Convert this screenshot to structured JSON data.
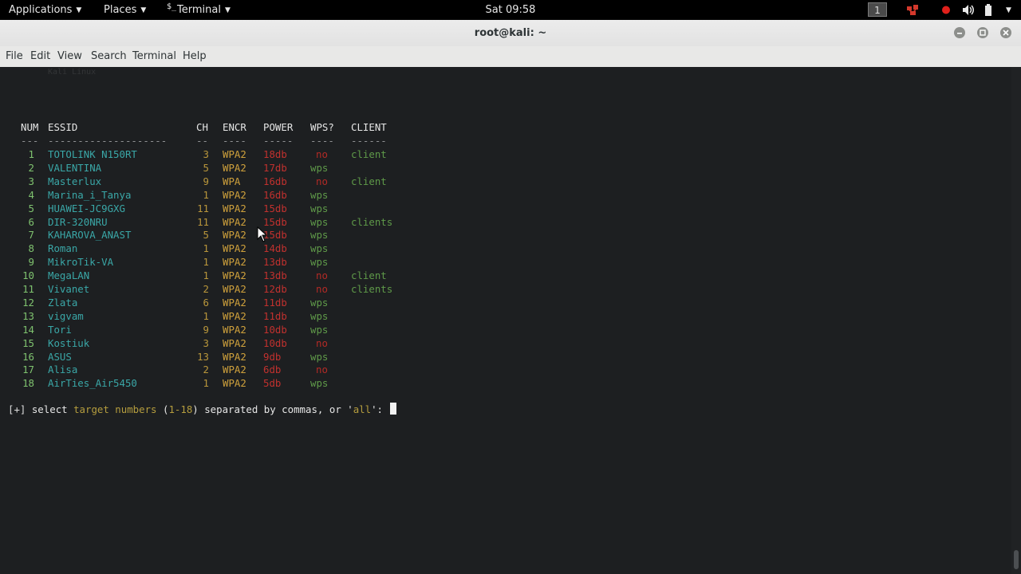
{
  "panel": {
    "applications": "Applications",
    "places": "Places",
    "terminal": "Terminal",
    "terminal_icon_glyph": "$_",
    "clock": "Sat 09:58",
    "workspace": "1",
    "icons": [
      "workspace-indicator",
      "network-icon",
      "record-icon",
      "volume-icon",
      "battery-icon",
      "power-menu-arrow"
    ]
  },
  "window": {
    "title": "root@kali: ~",
    "controls": [
      "minimize-icon",
      "maximize-icon",
      "close-icon"
    ]
  },
  "menu": [
    "File",
    "Edit",
    "View",
    "Search",
    "Terminal",
    "Help"
  ],
  "terminal": {
    "faint_line": "Kali Linux",
    "headers": {
      "num": "NUM",
      "essid": "ESSID",
      "ch": "CH",
      "encr": "ENCR",
      "power": "POWER",
      "wps": "WPS?",
      "client": "CLIENT"
    },
    "dashes": {
      "num": "---",
      "essid": "--------------------",
      "ch": "--",
      "encr": "----",
      "power": "-----",
      "wps": "----",
      "client": "------"
    },
    "rows": [
      {
        "num": "1",
        "essid": "TOTOLINK N150RT",
        "ch": "3",
        "encr": "WPA2",
        "power": "18db",
        "wps": "no",
        "client": "client"
      },
      {
        "num": "2",
        "essid": "VALENTINA",
        "ch": "5",
        "encr": "WPA2",
        "power": "17db",
        "wps": "wps",
        "client": ""
      },
      {
        "num": "3",
        "essid": "Masterlux",
        "ch": "9",
        "encr": "WPA",
        "power": "16db",
        "wps": "no",
        "client": "client"
      },
      {
        "num": "4",
        "essid": "Marina_i_Tanya",
        "ch": "1",
        "encr": "WPA2",
        "power": "16db",
        "wps": "wps",
        "client": ""
      },
      {
        "num": "5",
        "essid": "HUAWEI-JC9GXG",
        "ch": "11",
        "encr": "WPA2",
        "power": "15db",
        "wps": "wps",
        "client": ""
      },
      {
        "num": "6",
        "essid": "DIR-320NRU",
        "ch": "11",
        "encr": "WPA2",
        "power": "15db",
        "wps": "wps",
        "client": "clients"
      },
      {
        "num": "7",
        "essid": "KAHAROVA_ANAST",
        "ch": "5",
        "encr": "WPA2",
        "power": "15db",
        "wps": "wps",
        "client": ""
      },
      {
        "num": "8",
        "essid": "Roman",
        "ch": "1",
        "encr": "WPA2",
        "power": "14db",
        "wps": "wps",
        "client": ""
      },
      {
        "num": "9",
        "essid": "MikroTik-VA",
        "ch": "1",
        "encr": "WPA2",
        "power": "13db",
        "wps": "wps",
        "client": ""
      },
      {
        "num": "10",
        "essid": "MegaLAN",
        "ch": "1",
        "encr": "WPA2",
        "power": "13db",
        "wps": "no",
        "client": "client"
      },
      {
        "num": "11",
        "essid": "Vivanet",
        "ch": "2",
        "encr": "WPA2",
        "power": "12db",
        "wps": "no",
        "client": "clients"
      },
      {
        "num": "12",
        "essid": "Zlata",
        "ch": "6",
        "encr": "WPA2",
        "power": "11db",
        "wps": "wps",
        "client": ""
      },
      {
        "num": "13",
        "essid": "vigvam",
        "ch": "1",
        "encr": "WPA2",
        "power": "11db",
        "wps": "wps",
        "client": ""
      },
      {
        "num": "14",
        "essid": "Tori",
        "ch": "9",
        "encr": "WPA2",
        "power": "10db",
        "wps": "wps",
        "client": ""
      },
      {
        "num": "15",
        "essid": "Kostiuk",
        "ch": "3",
        "encr": "WPA2",
        "power": "10db",
        "wps": "no",
        "client": ""
      },
      {
        "num": "16",
        "essid": "ASUS",
        "ch": "13",
        "encr": "WPA2",
        "power": "9db",
        "wps": "wps",
        "client": ""
      },
      {
        "num": "17",
        "essid": "Alisa",
        "ch": "2",
        "encr": "WPA2",
        "power": "6db",
        "wps": "no",
        "client": ""
      },
      {
        "num": "18",
        "essid": "AirTies_Air5450",
        "ch": "1",
        "encr": "WPA2",
        "power": "5db",
        "wps": "wps",
        "client": ""
      }
    ],
    "prompt": {
      "marker": "[+]",
      "text_a": " select ",
      "text_b": "target numbers",
      "text_c": " (",
      "text_d": "1-18",
      "text_e": ") separated by commas, or '",
      "text_f": "all",
      "text_g": "': "
    }
  },
  "colors": {
    "terminal_bg": "#1d1f21",
    "essid": "#3aa7a7",
    "num": "#7fc36f",
    "encr": "#cfa13c",
    "power": "#c1312e",
    "wps": "#5f9a49",
    "no": "#b32a26"
  }
}
